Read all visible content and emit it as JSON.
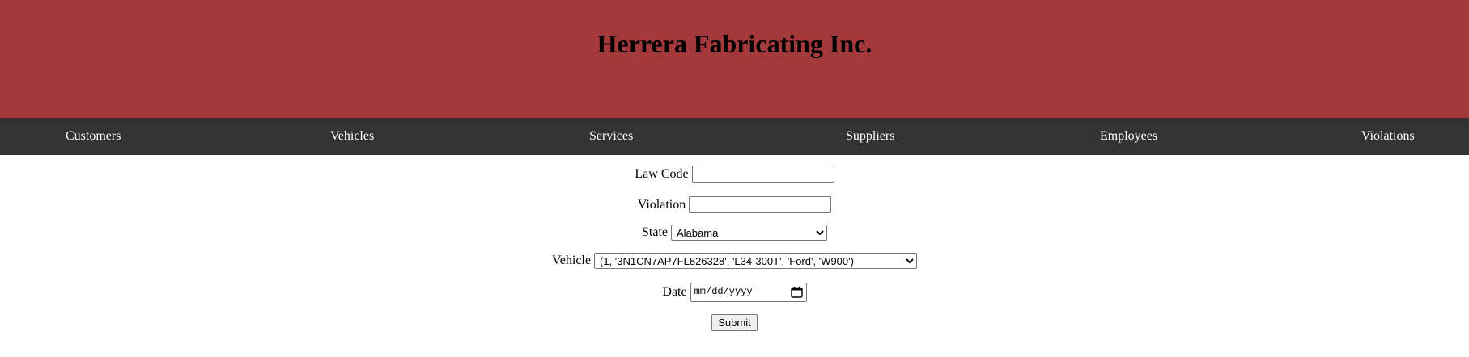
{
  "header": {
    "title": "Herrera Fabricating Inc."
  },
  "nav": {
    "items": [
      {
        "label": "Customers"
      },
      {
        "label": "Vehicles"
      },
      {
        "label": "Services"
      },
      {
        "label": "Suppliers"
      },
      {
        "label": "Employees"
      },
      {
        "label": "Violations"
      }
    ]
  },
  "form": {
    "law_code": {
      "label": "Law Code",
      "value": ""
    },
    "violation": {
      "label": "Violation",
      "value": ""
    },
    "state": {
      "label": "State",
      "selected": "Alabama"
    },
    "vehicle": {
      "label": "Vehicle",
      "selected": "(1, '3N1CN7AP7FL826328', 'L34-300T', 'Ford', 'W900')"
    },
    "date": {
      "label": "Date",
      "placeholder": "mm/dd/yyyy",
      "icon": "calendar-icon"
    },
    "submit_label": "Submit"
  },
  "colors": {
    "header_bg": "#a3393b",
    "nav_bg": "#333333",
    "nav_text": "#ffffff"
  }
}
